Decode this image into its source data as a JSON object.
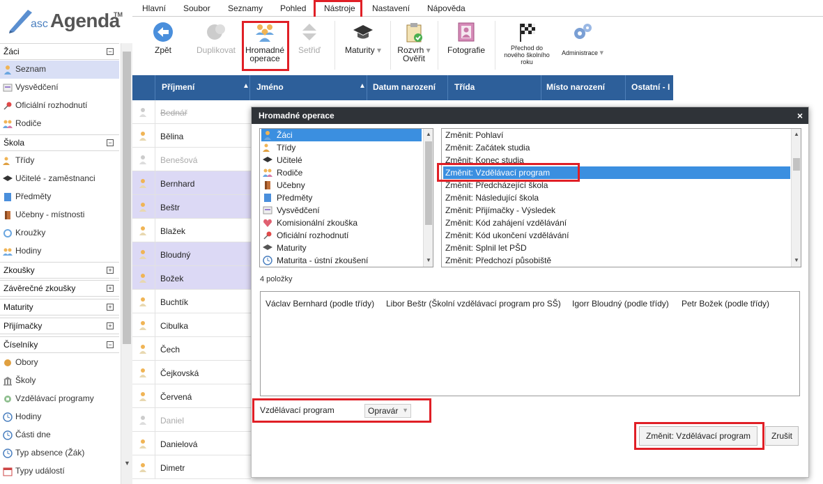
{
  "app": {
    "logo_prefix": "asc",
    "logo_name": "Agenda",
    "logo_tm": "TM"
  },
  "menu": [
    "Hlavní",
    "Soubor",
    "Seznamy",
    "Pohled",
    "Nástroje",
    "Nastavení",
    "Nápověda"
  ],
  "toolbar": {
    "back": "Zpět",
    "duplicate": "Duplikovat",
    "bulk_line1": "Hromadné",
    "bulk_line2": "operace",
    "sort": "Setřiď",
    "maturity": "Maturity",
    "schedule_line1": "Rozvrh",
    "schedule_line2": "Ověřit",
    "photos": "Fotografie",
    "transition_line1": "Přechod do",
    "transition_line2": "nového školního",
    "transition_line3": "roku",
    "admin": "Administrace"
  },
  "sidebar": {
    "sections": [
      {
        "title": "Žáci",
        "toggle": "−"
      },
      {
        "title": "Škola",
        "toggle": "−"
      },
      {
        "title": "Zkoušky",
        "toggle": "+"
      },
      {
        "title": "Závěrečné zkoušky",
        "toggle": "+"
      },
      {
        "title": "Maturity",
        "toggle": "+"
      },
      {
        "title": "Přijímačky",
        "toggle": "+"
      },
      {
        "title": "Číselníky",
        "toggle": "−"
      }
    ],
    "zaci_items": [
      "Seznam",
      "Vysvědčení",
      "Oficiální rozhodnutí",
      "Rodiče"
    ],
    "skola_items": [
      "Třídy",
      "Učitelé - zaměstnanci",
      "Předměty",
      "Učebny - místnosti",
      "Kroužky",
      "Hodiny"
    ],
    "ciselniky_items": [
      "Obory",
      "Školy",
      "Vzdělávací programy",
      "Hodiny",
      "Části dne",
      "Typ absence (Žák)",
      "Typy událostí"
    ]
  },
  "grid": {
    "columns": [
      "Příjmení",
      "Jméno",
      "Datum narození",
      "Třída",
      "Místo narození",
      "Ostatní - I"
    ],
    "rows": [
      "Bednář",
      "Bělina",
      "Benešová",
      "Bernhard",
      "Beštr",
      "Blažek",
      "Bloudný",
      "Božek",
      "Buchtík",
      "Cibulka",
      "Čech",
      "Čejkovská",
      "Červená",
      "Daniel",
      "Danielová",
      "Dimetr"
    ]
  },
  "dialog": {
    "title": "Hromadné operace",
    "close": "×",
    "left_list": [
      "Žáci",
      "Třídy",
      "Učitelé",
      "Rodiče",
      "Učebny",
      "Předměty",
      "Vysvědčení",
      "Komisionální zkouška",
      "Oficiální rozhodnutí",
      "Maturity",
      "Maturita - ústní zkoušení"
    ],
    "right_list": [
      "Změnit: Pohlaví",
      "Změnit: Začátek studia",
      "Změnit: Konec studia",
      "Změnit: Vzdělávací program",
      "Změnit: Předcházející škola",
      "Změnit: Následující škola",
      "Změnit: Přijímačky - Výsledek",
      "Změnit: Kód zahájení vzdělávání",
      "Změnit: Kód ukončení vzdělávání",
      "Změnit: Splnil let PŠD",
      "Změnit: Předchozí působiště"
    ],
    "count": "4 položky",
    "items": [
      "Václav Bernhard (podle třídy)",
      "Libor Beštr (Školní vzdělávací program pro SŠ)",
      "Igorr Bloudný (podle třídy)",
      "Petr Božek (podle třídy)"
    ],
    "program_label": "Vzdělávací program",
    "program_value": "Opravár",
    "change_button": "Změnit: Vzdělávací program",
    "cancel_button": "Zrušit"
  },
  "colors": {
    "grid_header": "#2d5f9a",
    "selection": "#3b8fe0",
    "highlight": "#e01f26",
    "row_selected": "#dcd9f5"
  }
}
